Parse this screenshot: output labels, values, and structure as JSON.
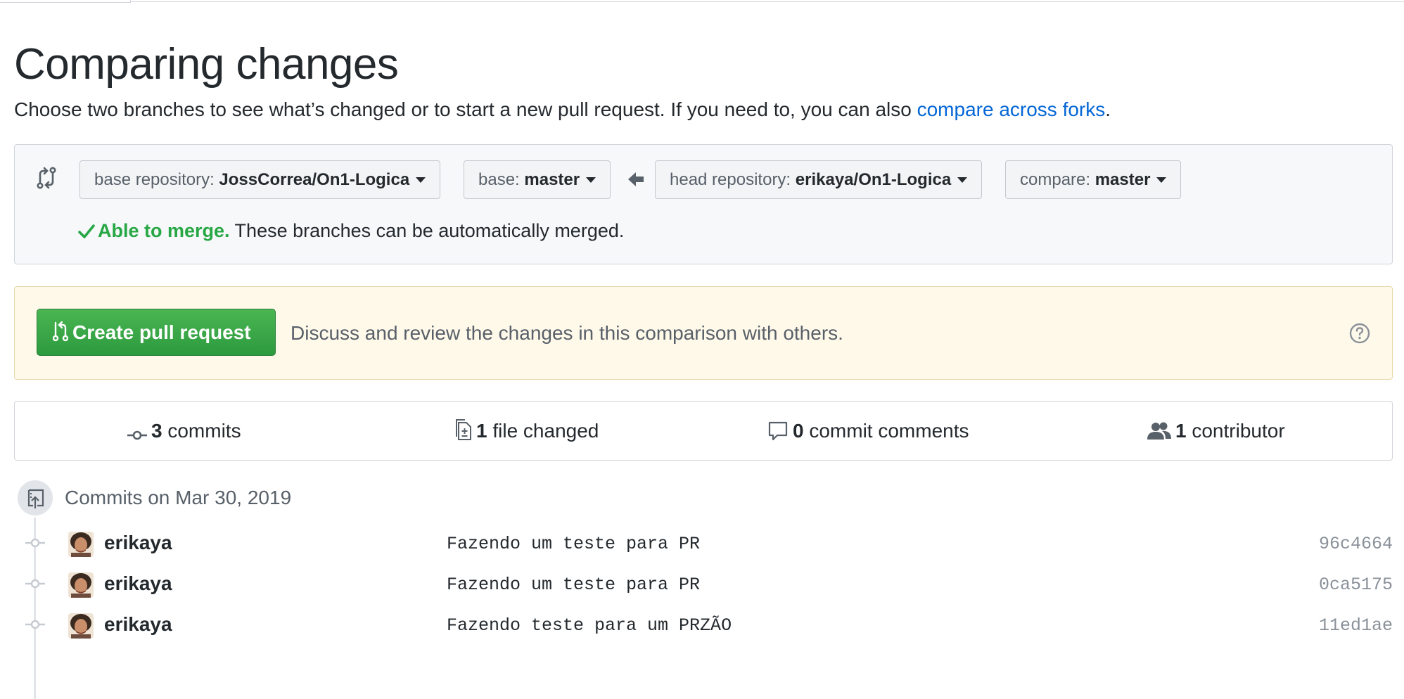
{
  "page": {
    "title": "Comparing changes",
    "subtitle_text": "Choose two branches to see what’s changed or to start a new pull request. If you need to, you can also ",
    "subtitle_link": "compare across forks",
    "subtitle_end": "."
  },
  "range": {
    "base_repo": {
      "label": "base repository: ",
      "value": "JossCorrea/On1-Logica"
    },
    "base": {
      "label": "base: ",
      "value": "master"
    },
    "head_repo": {
      "label": "head repository: ",
      "value": "erikaya/On1-Logica"
    },
    "compare": {
      "label": "compare: ",
      "value": "master"
    },
    "merge_status_ok": "Able to merge.",
    "merge_status_text": " These branches can be automatically merged."
  },
  "pull_request": {
    "button_label": "Create pull request",
    "description": "Discuss and review the changes in this comparison with others."
  },
  "stats": {
    "commits": {
      "count": "3",
      "label": " commits"
    },
    "files": {
      "count": "1",
      "label": " file changed"
    },
    "comments": {
      "count": "0",
      "label": " commit comments"
    },
    "contributors": {
      "count": "1",
      "label": " contributor"
    }
  },
  "commits": {
    "date_heading": "Commits on Mar 30, 2019",
    "items": [
      {
        "author": "erikaya",
        "message": "Fazendo um teste para PR",
        "sha": "96c4664"
      },
      {
        "author": "erikaya",
        "message": "Fazendo um teste para PR",
        "sha": "0ca5175"
      },
      {
        "author": "erikaya",
        "message": "Fazendo teste para um PRZÃO",
        "sha": "11ed1ae"
      }
    ]
  },
  "colors": {
    "accent_link": "#0366d6",
    "merge_ok": "#28a745",
    "pr_button": "#2c9a3f",
    "pr_box_bg": "#fff9ea"
  },
  "icons": [
    "git-compare-icon",
    "arrow-left-icon",
    "check-icon",
    "git-pull-request-icon",
    "question-icon",
    "git-commit-icon",
    "diff-icon",
    "comment-icon",
    "people-icon",
    "repo-push-icon"
  ]
}
